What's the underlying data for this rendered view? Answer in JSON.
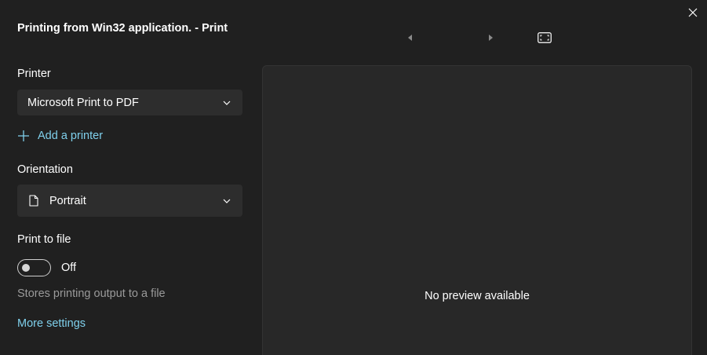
{
  "window": {
    "title": "Printing from Win32 application. - Print",
    "close_icon": "close-icon"
  },
  "printer": {
    "label": "Printer",
    "selected": "Microsoft Print to PDF",
    "add_printer_label": "Add a printer"
  },
  "orientation": {
    "label": "Orientation",
    "selected": "Portrait",
    "icon": "page-icon"
  },
  "print_to_file": {
    "label": "Print to file",
    "toggle_state": "Off",
    "helper_text": "Stores printing output to a file"
  },
  "more_settings_label": "More settings",
  "preview": {
    "message": "No preview available",
    "prev_icon": "triangle-left-icon",
    "next_icon": "triangle-right-icon",
    "fit_icon": "fit-to-window-icon"
  },
  "colors": {
    "background": "#202020",
    "dropdown_bg": "#2d2d2d",
    "link": "#7fd0ec",
    "muted_text": "#9a9a9a"
  }
}
